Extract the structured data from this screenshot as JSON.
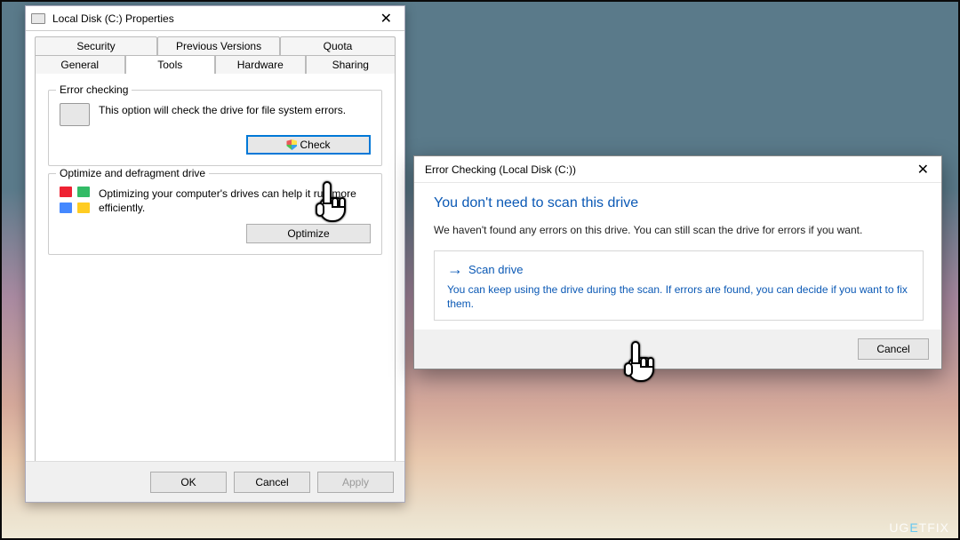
{
  "properties_dialog": {
    "title": "Local Disk (C:) Properties",
    "tabs_row1": [
      "Security",
      "Previous Versions",
      "Quota"
    ],
    "tabs_row2": [
      "General",
      "Tools",
      "Hardware",
      "Sharing"
    ],
    "active_tab": "Tools",
    "error_checking": {
      "title": "Error checking",
      "description": "This option will check the drive for file system errors.",
      "button": "Check"
    },
    "optimize": {
      "title": "Optimize and defragment drive",
      "description": "Optimizing your computer's drives can help it run more efficiently.",
      "button": "Optimize"
    },
    "footer": {
      "ok": "OK",
      "cancel": "Cancel",
      "apply": "Apply"
    }
  },
  "error_dialog": {
    "title": "Error Checking (Local Disk (C:))",
    "heading": "You don't need to scan this drive",
    "message": "We haven't found any errors on this drive. You can still scan the drive for errors if you want.",
    "scan": {
      "title": "Scan drive",
      "description": "You can keep using the drive during the scan. If errors are found, you can decide if you want to fix them."
    },
    "cancel": "Cancel"
  },
  "watermark": {
    "pre": "UG",
    "accent": "E",
    "post": "TFIX"
  }
}
